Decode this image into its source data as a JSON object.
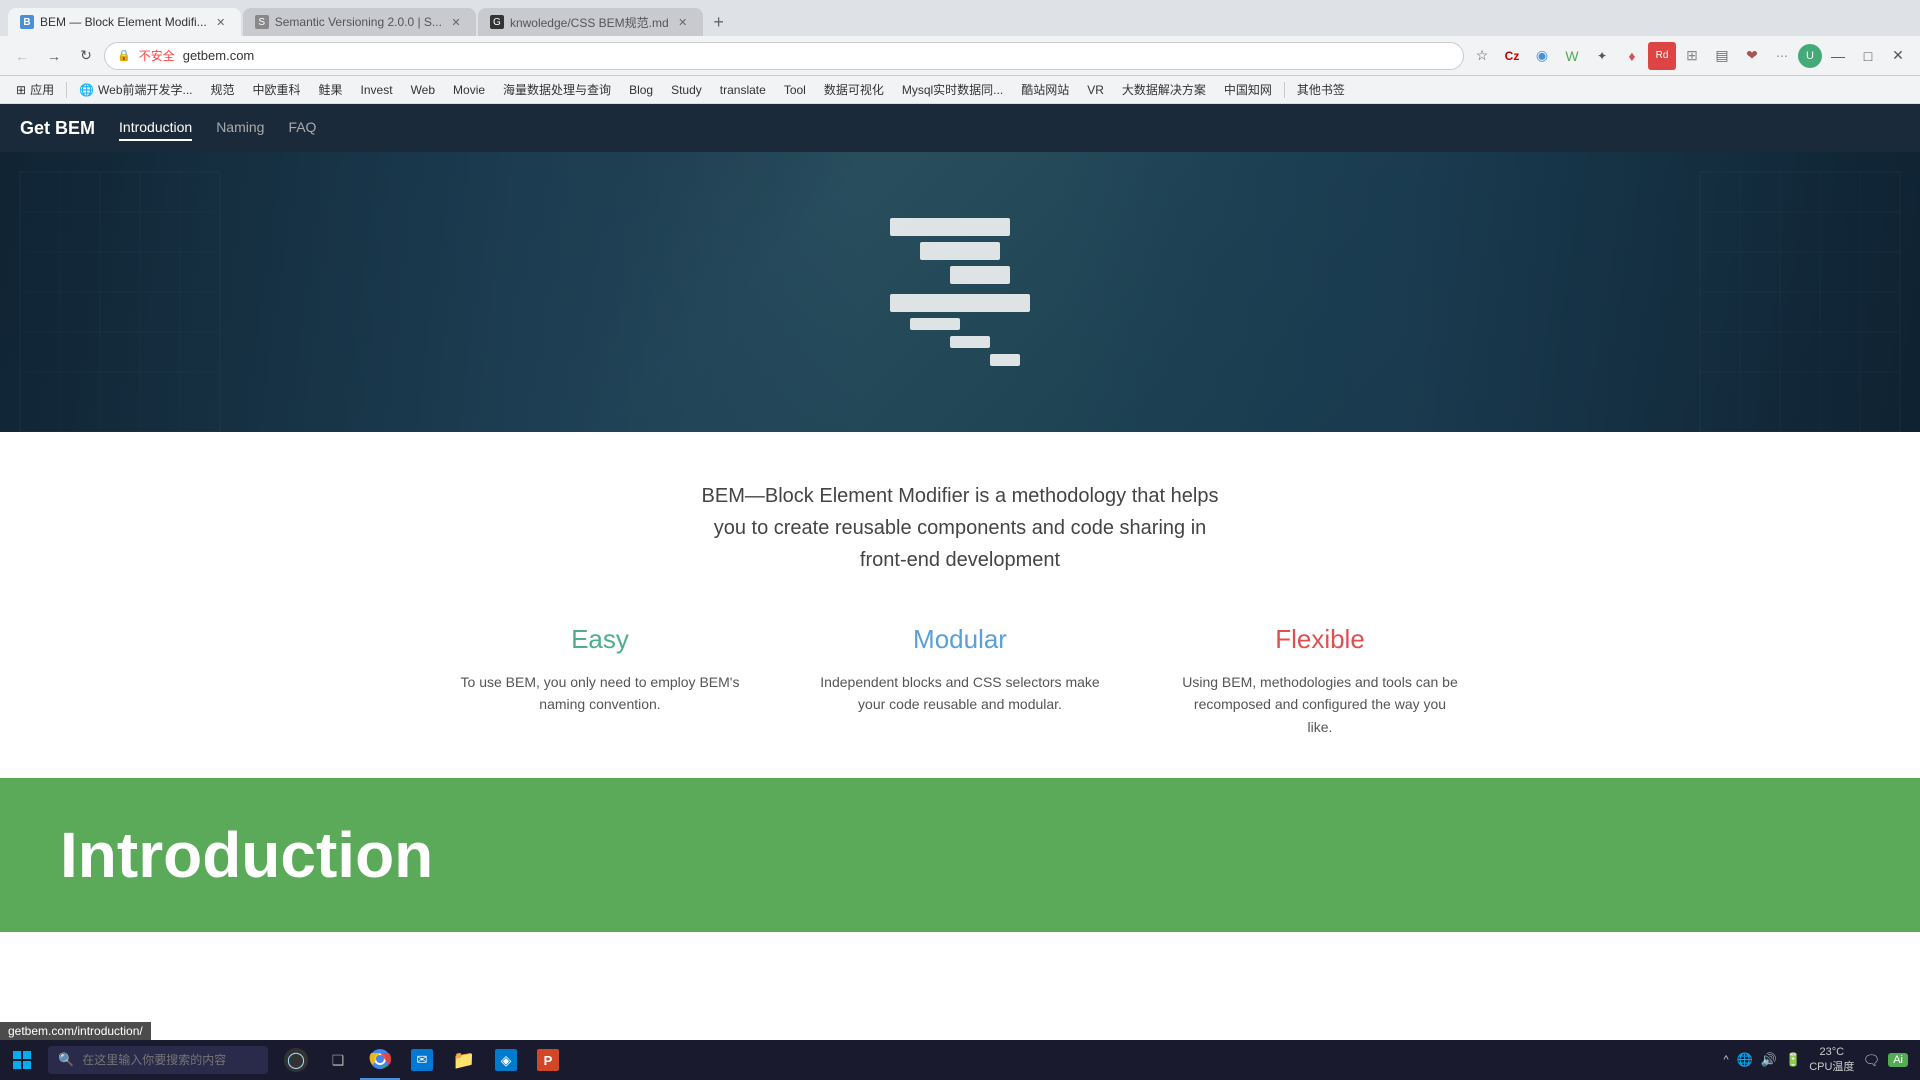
{
  "browser": {
    "tabs": [
      {
        "id": "tab1",
        "title": "BEM — Block Element Modifi...",
        "favicon_color": "#4a90d9",
        "active": true,
        "favicon_char": "B"
      },
      {
        "id": "tab2",
        "title": "Semantic Versioning 2.0.0 | S...",
        "favicon_color": "#888",
        "active": false,
        "favicon_char": "S"
      },
      {
        "id": "tab3",
        "title": "knwoledge/CSS BEM规范.md",
        "favicon_color": "#333",
        "active": false,
        "favicon_char": "G"
      }
    ],
    "address_bar": {
      "url": "getbem.com",
      "security": "不安全"
    },
    "bookmarks": [
      {
        "label": "应用",
        "icon": "⊞"
      },
      {
        "label": "Web前端开发学...",
        "icon": "🌐"
      },
      {
        "label": "规范",
        "icon": ""
      },
      {
        "label": "中欧重科",
        "icon": ""
      },
      {
        "label": "鲑果",
        "icon": ""
      },
      {
        "label": "Invest",
        "icon": ""
      },
      {
        "label": "Web",
        "icon": ""
      },
      {
        "label": "Movie",
        "icon": ""
      },
      {
        "label": "海量数据处理与查询",
        "icon": ""
      },
      {
        "label": "Blog",
        "icon": ""
      },
      {
        "label": "Study",
        "icon": ""
      },
      {
        "label": "translate",
        "icon": ""
      },
      {
        "label": "Tool",
        "icon": ""
      },
      {
        "label": "数据可视化",
        "icon": ""
      },
      {
        "label": "Mysql实时数据同...",
        "icon": ""
      },
      {
        "label": "酷站网站",
        "icon": ""
      },
      {
        "label": "VR",
        "icon": ""
      },
      {
        "label": "大数据解决方案",
        "icon": ""
      },
      {
        "label": "中国知网",
        "icon": ""
      },
      {
        "label": "其他书签",
        "icon": ""
      }
    ]
  },
  "site": {
    "nav": {
      "logo": "Get BEM",
      "links": [
        {
          "label": "Introduction",
          "active": true
        },
        {
          "label": "Naming",
          "active": false
        },
        {
          "label": "FAQ",
          "active": false
        }
      ]
    },
    "tagline": "BEM—Block Element Modifier is a methodology that helps you to create reusable components and code sharing in front-end development",
    "features": [
      {
        "title": "Easy",
        "color_class": "easy",
        "description": "To use BEM, you only need to employ BEM's naming convention."
      },
      {
        "title": "Modular",
        "color_class": "modular",
        "description": "Independent blocks and CSS selectors make your code reusable and modular."
      },
      {
        "title": "Flexible",
        "color_class": "flexible",
        "description": "Using BEM, methodologies and tools can be recomposed and configured the way you like."
      }
    ],
    "intro_section": {
      "title": "Introduction"
    }
  },
  "taskbar": {
    "search_placeholder": "在这里输入你要搜索的内容",
    "apps": [
      {
        "id": "windows",
        "color": "#0078d4",
        "char": "⊞"
      },
      {
        "id": "cortana",
        "color": "#555",
        "char": "◯"
      },
      {
        "id": "taskview",
        "color": "#555",
        "char": "❑"
      },
      {
        "id": "chrome",
        "color": "#ea4335",
        "char": "●"
      },
      {
        "id": "email",
        "color": "#0078d4",
        "char": "✉"
      },
      {
        "id": "files",
        "color": "#ffa500",
        "char": "📁"
      },
      {
        "id": "vscode",
        "color": "#007acc",
        "char": "◈"
      },
      {
        "id": "ppt",
        "color": "#d24726",
        "char": "P"
      }
    ],
    "sys_icons": [
      "^",
      "🔊",
      "🔋"
    ],
    "clock": {
      "time": "23°C",
      "label": "CPU温度"
    }
  },
  "status_url": "getbem.com/introduction/"
}
